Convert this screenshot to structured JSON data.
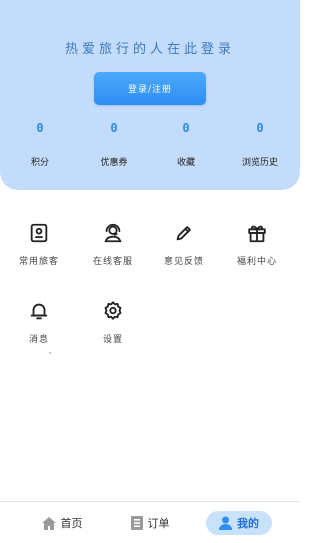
{
  "header": {
    "slogan": "热爱旅行的人在此登录",
    "login_button": "登录/注册",
    "stats": [
      {
        "value": "0",
        "label": "积分"
      },
      {
        "value": "0",
        "label": "优惠券"
      },
      {
        "value": "0",
        "label": "收藏"
      },
      {
        "value": "0",
        "label": "浏览历史"
      }
    ]
  },
  "menu": {
    "items": [
      {
        "label": "常用旅客",
        "icon": "contact-card-icon"
      },
      {
        "label": "在线客服",
        "icon": "headset-icon"
      },
      {
        "label": "意见反馈",
        "icon": "pencil-icon"
      },
      {
        "label": "福利中心",
        "icon": "gift-icon"
      },
      {
        "label": "消息",
        "icon": "bell-icon"
      },
      {
        "label": "设置",
        "icon": "gear-icon"
      }
    ]
  },
  "tabbar": {
    "tabs": [
      {
        "label": "首页",
        "icon": "home-icon",
        "active": false
      },
      {
        "label": "订单",
        "icon": "order-list-icon",
        "active": false
      },
      {
        "label": "我的",
        "icon": "user-icon",
        "active": true
      }
    ]
  },
  "colors": {
    "header_bg": "#c4dcfb",
    "accent": "#2f8ef3",
    "stat_value": "#2b8be6",
    "active_tab_bg": "#c9e2fb"
  }
}
